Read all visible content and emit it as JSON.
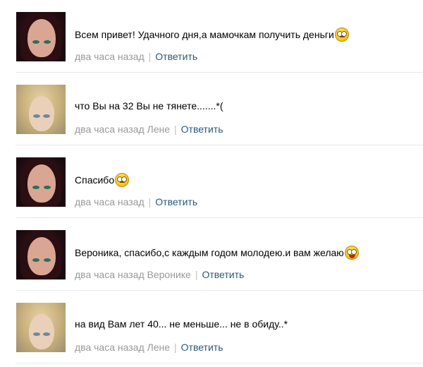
{
  "comments": [
    {
      "avatar": "dark",
      "text": "Всем привет! Удачного дня,а мамочкам получить деньги",
      "emoji": "rolling-eyes-emoji",
      "time": "два часа назад",
      "reply": "Ответить"
    },
    {
      "avatar": "blonde",
      "text": "что Вы на 32 Вы не тянете.......*(",
      "emoji": null,
      "time": "два часа назад Лене",
      "reply": "Ответить"
    },
    {
      "avatar": "dark",
      "text": "Спасибо",
      "emoji": "rolling-eyes-emoji",
      "time": "два часа назад",
      "reply": "Ответить"
    },
    {
      "avatar": "dark",
      "text": "Вероника, спасибо,с каждым годом молодею.и вам желаю",
      "emoji": "wide-eyed-emoji",
      "time": "два часа назад Веронике",
      "reply": "Ответить"
    },
    {
      "avatar": "blonde",
      "text": "на вид Вам лет 40... не меньше... не в обиду..*",
      "emoji": null,
      "time": "два часа назад Лене",
      "reply": "Ответить"
    }
  ],
  "colors": {
    "link": "#2b587a",
    "meta": "#999999",
    "separator": "#e4e8ed"
  }
}
